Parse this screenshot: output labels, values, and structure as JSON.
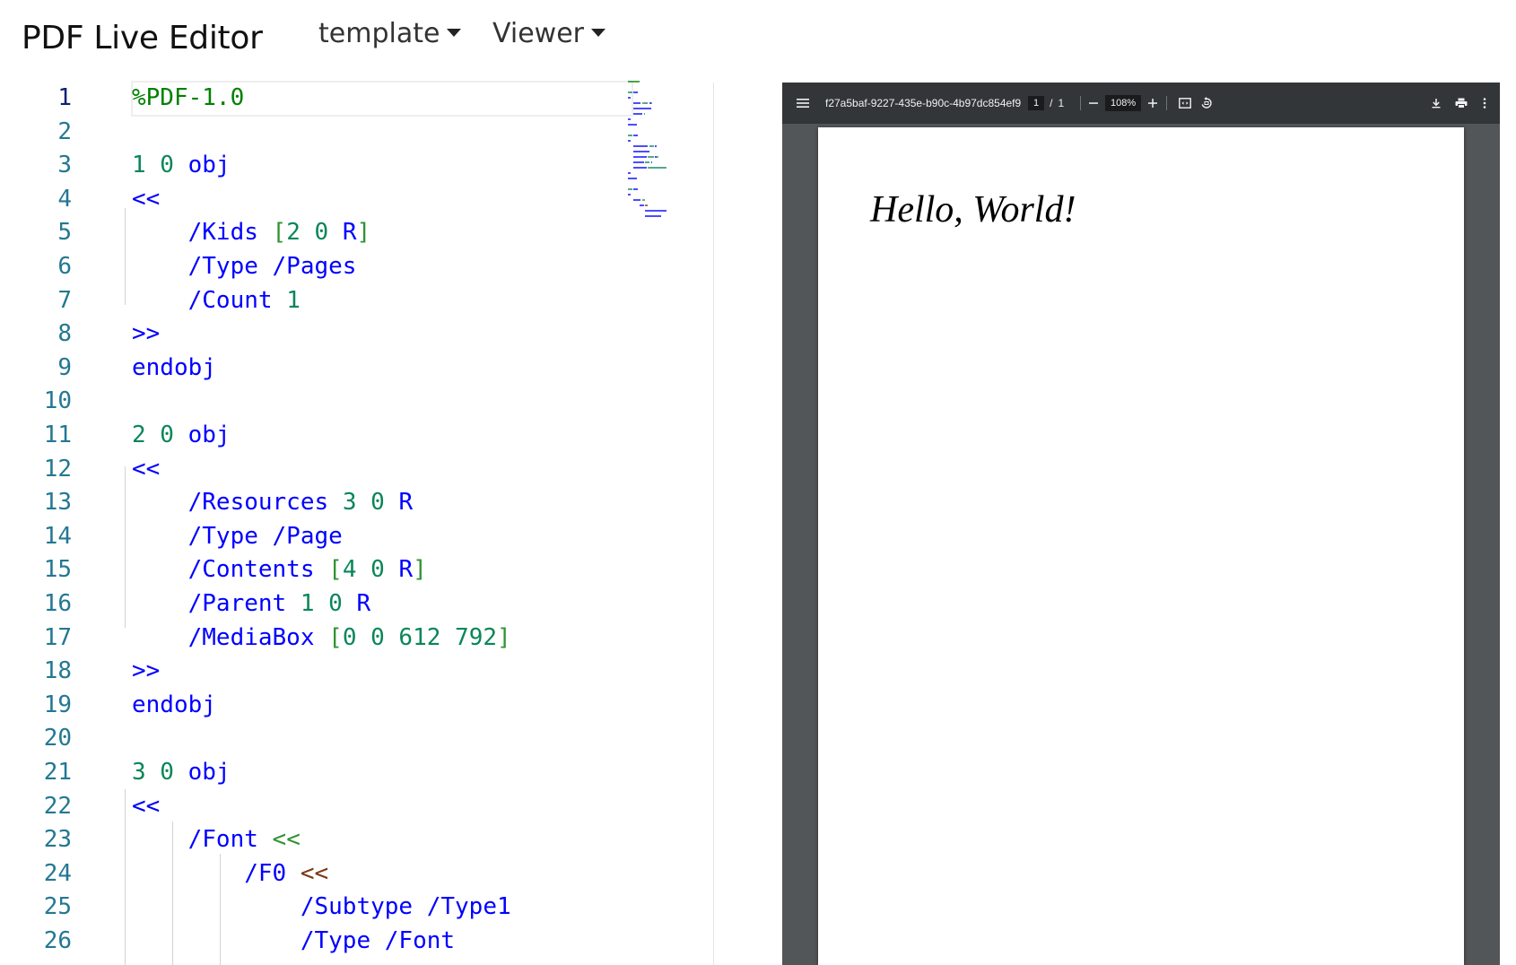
{
  "header": {
    "brand": "PDF Live Editor",
    "menus": [
      {
        "label": "template"
      },
      {
        "label": "Viewer"
      }
    ]
  },
  "editor": {
    "active_line": 1,
    "lines": [
      {
        "n": "1",
        "tokens": [
          {
            "t": "%PDF-1.0",
            "c": "com"
          }
        ]
      },
      {
        "n": "2",
        "tokens": []
      },
      {
        "n": "3",
        "tokens": [
          {
            "t": "1 0 ",
            "c": "num"
          },
          {
            "t": "obj",
            "c": "kw"
          }
        ]
      },
      {
        "n": "4",
        "tokens": [
          {
            "t": "<<",
            "c": "kw"
          }
        ]
      },
      {
        "n": "5",
        "tokens": [
          {
            "t": "    /Kids ",
            "c": "kw"
          },
          {
            "t": "[",
            "c": "br1"
          },
          {
            "t": "2 0 ",
            "c": "num"
          },
          {
            "t": "R",
            "c": "kw"
          },
          {
            "t": "]",
            "c": "br1"
          }
        ]
      },
      {
        "n": "6",
        "tokens": [
          {
            "t": "    /Type /Pages",
            "c": "kw"
          }
        ]
      },
      {
        "n": "7",
        "tokens": [
          {
            "t": "    /Count ",
            "c": "kw"
          },
          {
            "t": "1",
            "c": "num"
          }
        ]
      },
      {
        "n": "8",
        "tokens": [
          {
            "t": ">>",
            "c": "kw"
          }
        ]
      },
      {
        "n": "9",
        "tokens": [
          {
            "t": "endobj",
            "c": "kw"
          }
        ]
      },
      {
        "n": "10",
        "tokens": []
      },
      {
        "n": "11",
        "tokens": [
          {
            "t": "2 0 ",
            "c": "num"
          },
          {
            "t": "obj",
            "c": "kw"
          }
        ]
      },
      {
        "n": "12",
        "tokens": [
          {
            "t": "<<",
            "c": "kw"
          }
        ]
      },
      {
        "n": "13",
        "tokens": [
          {
            "t": "    /Resources ",
            "c": "kw"
          },
          {
            "t": "3 0 ",
            "c": "num"
          },
          {
            "t": "R",
            "c": "kw"
          }
        ]
      },
      {
        "n": "14",
        "tokens": [
          {
            "t": "    /Type /Page",
            "c": "kw"
          }
        ]
      },
      {
        "n": "15",
        "tokens": [
          {
            "t": "    /Contents ",
            "c": "kw"
          },
          {
            "t": "[",
            "c": "br1"
          },
          {
            "t": "4 0 ",
            "c": "num"
          },
          {
            "t": "R",
            "c": "kw"
          },
          {
            "t": "]",
            "c": "br1"
          }
        ]
      },
      {
        "n": "16",
        "tokens": [
          {
            "t": "    /Parent ",
            "c": "kw"
          },
          {
            "t": "1 0 ",
            "c": "num"
          },
          {
            "t": "R",
            "c": "kw"
          }
        ]
      },
      {
        "n": "17",
        "tokens": [
          {
            "t": "    /MediaBox ",
            "c": "kw"
          },
          {
            "t": "[",
            "c": "br1"
          },
          {
            "t": "0 0 612 792",
            "c": "num"
          },
          {
            "t": "]",
            "c": "br1"
          }
        ]
      },
      {
        "n": "18",
        "tokens": [
          {
            "t": ">>",
            "c": "kw"
          }
        ]
      },
      {
        "n": "19",
        "tokens": [
          {
            "t": "endobj",
            "c": "kw"
          }
        ]
      },
      {
        "n": "20",
        "tokens": []
      },
      {
        "n": "21",
        "tokens": [
          {
            "t": "3 0 ",
            "c": "num"
          },
          {
            "t": "obj",
            "c": "kw"
          }
        ]
      },
      {
        "n": "22",
        "tokens": [
          {
            "t": "<<",
            "c": "kw"
          }
        ]
      },
      {
        "n": "23",
        "tokens": [
          {
            "t": "    /Font ",
            "c": "kw"
          },
          {
            "t": "<<",
            "c": "br1"
          }
        ]
      },
      {
        "n": "24",
        "tokens": [
          {
            "t": "        /F0 ",
            "c": "kw"
          },
          {
            "t": "<<",
            "c": "br2"
          }
        ]
      },
      {
        "n": "25",
        "tokens": [
          {
            "t": "            /Subtype /Type1",
            "c": "kw"
          }
        ]
      },
      {
        "n": "26",
        "tokens": [
          {
            "t": "            /Type /Font",
            "c": "kw"
          }
        ]
      }
    ]
  },
  "colors": {
    "keyword": "#0000ff",
    "number": "#098658",
    "comment": "#008000",
    "bracket_level1": "#319331",
    "bracket_level2": "#7b3814",
    "line_number": "#237893",
    "viewer_toolbar": "#323639",
    "viewer_background": "#525659"
  },
  "viewer": {
    "title": "f27a5baf-9227-435e-b90c-4b97dc854ef9",
    "page_current": "1",
    "page_separator": "/",
    "page_total": "1",
    "zoom": "108%",
    "icons": [
      "menu-icon",
      "zoom-out-icon",
      "zoom-in-icon",
      "fit-page-icon",
      "rotate-icon",
      "download-icon",
      "print-icon",
      "more-icon"
    ],
    "page_text": "Hello, World!"
  }
}
